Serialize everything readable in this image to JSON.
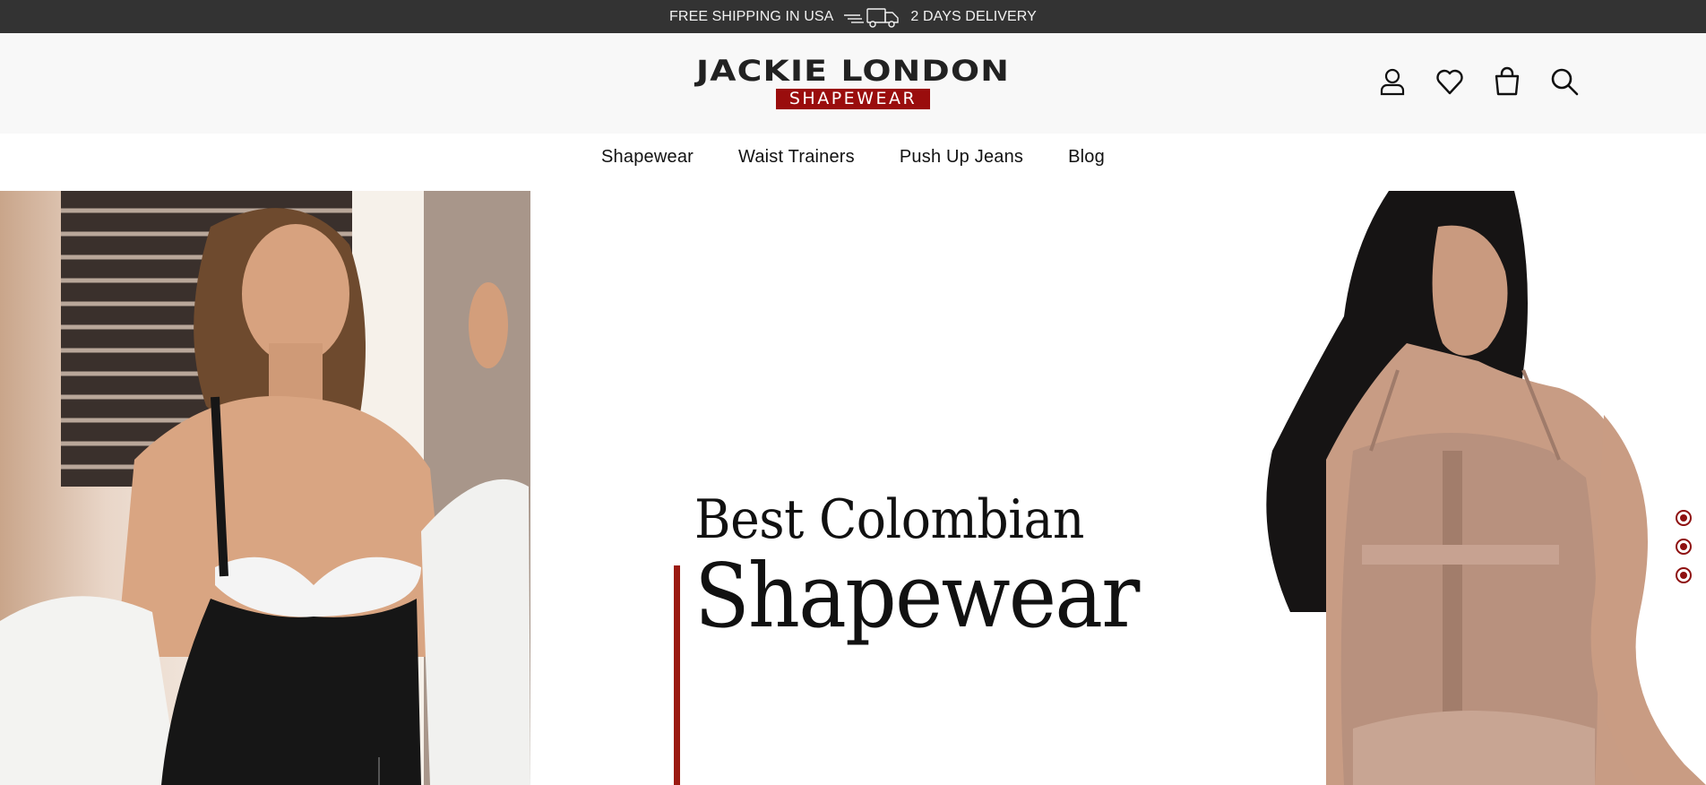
{
  "announcement": {
    "left_text": "FREE SHIPPING IN USA",
    "right_text": "2 DAYS DELIVERY",
    "icon": "delivery-truck-icon"
  },
  "header": {
    "logo_main": "JACKIE LONDON",
    "logo_sub": "SHAPEWEAR",
    "icons": [
      "account-icon",
      "wishlist-heart-icon",
      "shopping-bag-icon",
      "search-icon"
    ]
  },
  "nav": {
    "items": [
      {
        "label": "Shapewear"
      },
      {
        "label": "Waist Trainers"
      },
      {
        "label": "Push Up Jeans"
      },
      {
        "label": "Blog"
      }
    ]
  },
  "hero": {
    "headline_line1": "Best Colombian",
    "headline_line2": "Shapewear",
    "slides": 3,
    "active_slide": 1
  },
  "colors": {
    "topbar_bg": "#333333",
    "header_bg": "#f8f8f8",
    "brand_red": "#9a0d0d",
    "accent_bar": "#9b1a12"
  }
}
